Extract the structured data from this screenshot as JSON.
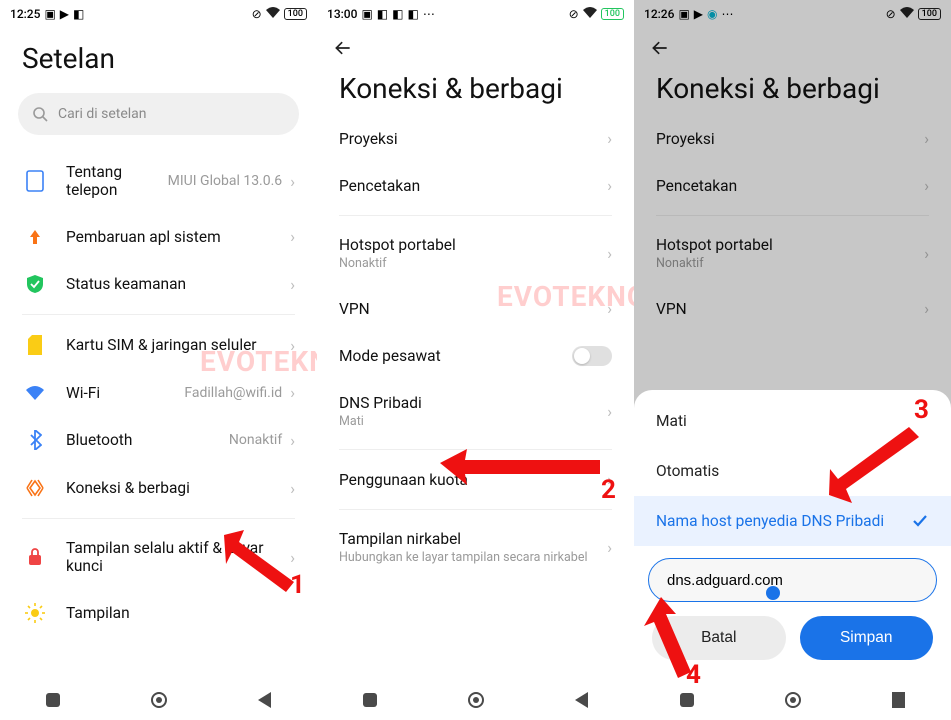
{
  "watermark": "EVOTEKNO.COM",
  "annotations": {
    "n1": "1",
    "n2": "2",
    "n3": "3",
    "n4": "4"
  },
  "screen1": {
    "status": {
      "time": "12:25",
      "battery": "100"
    },
    "title": "Setelan",
    "search_placeholder": "Cari di setelan",
    "items": {
      "about_phone": "Tentang telepon",
      "about_phone_val": "MIUI Global 13.0.6",
      "sysupdate": "Pembaruan apl sistem",
      "security": "Status keamanan",
      "sim": "Kartu SIM & jaringan seluler",
      "wifi": "Wi-Fi",
      "wifi_val": "Fadillah@wifi.id",
      "bt": "Bluetooth",
      "bt_val": "Nonaktif",
      "share": "Koneksi & berbagi",
      "aod": "Tampilan selalu aktif & Layar kunci",
      "display": "Tampilan"
    }
  },
  "screen2": {
    "status": {
      "time": "13:00",
      "battery": "100"
    },
    "title": "Koneksi & berbagi",
    "items": {
      "cast": "Proyeksi",
      "print": "Pencetakan",
      "hotspot": "Hotspot portabel",
      "hotspot_sub": "Nonaktif",
      "vpn": "VPN",
      "airplane": "Mode pesawat",
      "dns": "DNS Pribadi",
      "dns_sub": "Mati",
      "datausage": "Penggunaan kuota",
      "wdisplay": "Tampilan nirkabel",
      "wdisplay_sub": "Hubungkan ke layar tampilan secara nirkabel"
    }
  },
  "screen3": {
    "status": {
      "time": "12:26",
      "battery": "100"
    },
    "title": "Koneksi & berbagi",
    "items": {
      "cast": "Proyeksi",
      "print": "Pencetakan",
      "hotspot": "Hotspot portabel",
      "hotspot_sub": "Nonaktif",
      "vpn": "VPN"
    },
    "sheet": {
      "opt_off": "Mati",
      "opt_auto": "Otomatis",
      "opt_host": "Nama host penyedia DNS Pribadi",
      "input_value": "dns.adguard.com",
      "cancel": "Batal",
      "save": "Simpan"
    }
  }
}
